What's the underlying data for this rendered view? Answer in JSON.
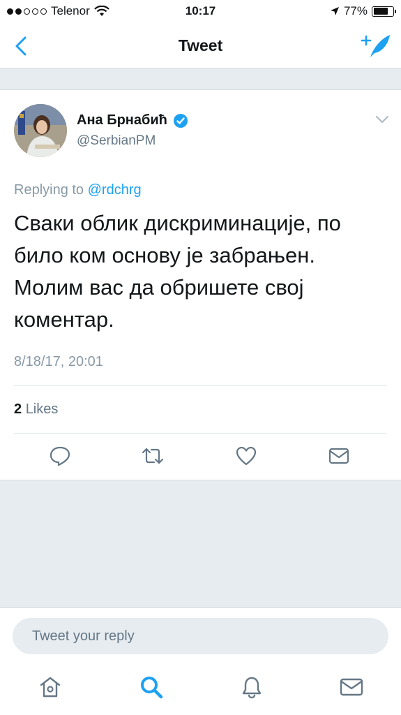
{
  "status_bar": {
    "carrier": "Telenor",
    "time": "10:17",
    "battery": "77%",
    "battery_level": 0.77
  },
  "nav": {
    "title": "Tweet"
  },
  "tweet": {
    "author_name": "Ана Брнабић",
    "author_handle": "@SerbianPM",
    "replying_prefix": "Replying to",
    "replying_to": "@rdchrg",
    "text": "Сваки облик дискриминације, по било ком основу је забрањен. Молим вас да обришете свој коментар.",
    "timestamp": "8/18/17, 20:01",
    "likes_count": "2",
    "likes_label": "Likes"
  },
  "reply": {
    "placeholder": "Tweet your reply"
  },
  "colors": {
    "accent": "#1da1f2",
    "background": "#e6ecf0",
    "secondary_text": "#657786",
    "icon_gray": "#657786"
  },
  "icons": {
    "back": "chevron-left-icon",
    "compose": "compose-quill-icon",
    "verified": "verified-badge-icon",
    "caret": "chevron-down-icon",
    "reply": "reply-bubble-icon",
    "retweet": "retweet-icon",
    "like": "heart-icon",
    "dm": "envelope-icon",
    "home": "home-icon",
    "search": "search-icon",
    "notifications": "bell-icon",
    "messages": "envelope-icon"
  }
}
